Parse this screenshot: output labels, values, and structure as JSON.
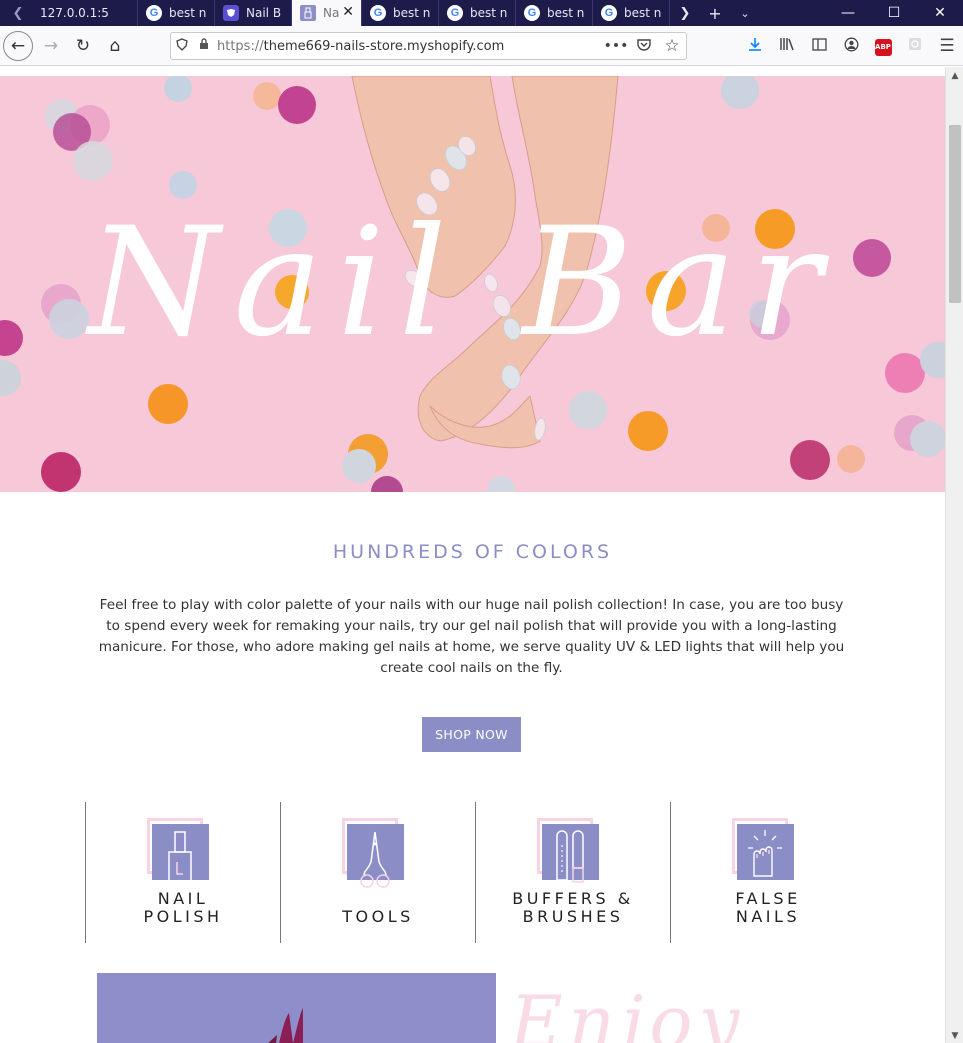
{
  "browser": {
    "tabs": [
      {
        "title": "127.0.0.1:5",
        "favicon": "none"
      },
      {
        "title": "best n",
        "favicon": "google-icon"
      },
      {
        "title": "Nail B",
        "favicon": "shield-icon"
      },
      {
        "title": "Na",
        "favicon": "nail-icon",
        "active": true
      },
      {
        "title": "best n",
        "favicon": "google-icon"
      },
      {
        "title": "best n",
        "favicon": "google-icon"
      },
      {
        "title": "best n",
        "favicon": "google-icon"
      },
      {
        "title": "best n",
        "favicon": "google-icon"
      }
    ],
    "url_prefix": "https://",
    "url_host": "theme669-nails-store.myshopify.com"
  },
  "hero": {
    "script_title": "Nail Bar"
  },
  "intro": {
    "title": "HUNDREDS OF COLORS",
    "body": "Feel free to play with color palette of your nails with our huge nail polish collection! In case, you are too busy to spend every week for remaking your nails, try our gel nail polish that will provide you with a long-lasting manicure. For those, who adore making gel nails at home, we serve quality UV & LED lights that will help you create cool nails on the fly.",
    "cta": "SHOP NOW"
  },
  "categories": [
    {
      "label": "NAIL\nPOLISH",
      "icon": "nail-polish-icon"
    },
    {
      "label": "TOOLS",
      "icon": "scissors-icon"
    },
    {
      "label": "BUFFERS &\nBRUSHES",
      "icon": "buffers-icon"
    },
    {
      "label": "FALSE\nNAILS",
      "icon": "false-nails-icon"
    }
  ],
  "promo": {
    "script_text": "Enjoy"
  },
  "colors": {
    "accent": "#8b8dc6",
    "hero_bg": "#f6c8d8",
    "pink_outline": "#f7d3e3",
    "tabstrip": "#1d1b4a"
  }
}
